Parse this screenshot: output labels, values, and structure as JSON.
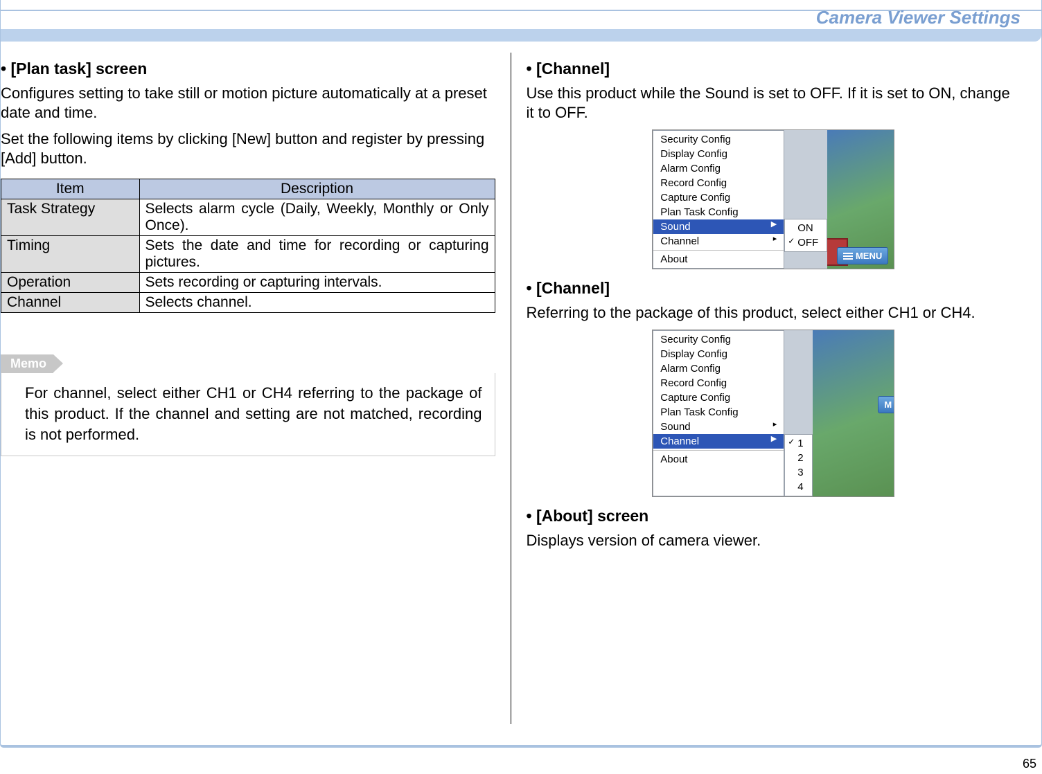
{
  "header": {
    "title": "Camera Viewer Settings"
  },
  "page_number": "65",
  "footer_ghost": "",
  "left": {
    "h1": "• [Plan task] screen",
    "p1": "Configures setting to take still or motion picture automatically at a preset date and time.",
    "p2": "Set the following items by clicking [New] button and register by pressing [Add] button.",
    "table": {
      "headers": [
        "Item",
        "Description"
      ],
      "rows": [
        {
          "item": "Task Strategy",
          "desc": "Selects alarm cycle (Daily, Weekly, Monthly or Only Once)."
        },
        {
          "item": "Timing",
          "desc": "Sets the date and time for recording or capturing pictures."
        },
        {
          "item": "Operation",
          "desc": "Sets recording or capturing intervals."
        },
        {
          "item": "Channel",
          "desc": "Selects channel."
        }
      ]
    },
    "memo_label": "Memo",
    "memo_text": "For channel, select either CH1 or CH4 referring to the package of this product. If the channel and setting are not matched, recording is not performed."
  },
  "right": {
    "h1": "• [Channel]",
    "p1": "Use this product while the Sound is set to OFF. If it is set to ON, change it to OFF.",
    "h2": "• [Channel]",
    "p2": "Referring to the package of this product, select either CH1 or CH4.",
    "h3": "• [About] screen",
    "p3": "Displays version of camera viewer."
  },
  "menu_items": {
    "m0": "Security Config",
    "m1": "Display Config",
    "m2": "Alarm Config",
    "m3": "Record Config",
    "m4": "Capture Config",
    "m5": "Plan Task Config",
    "m6": "Sound",
    "m7": "Channel",
    "m8": "About"
  },
  "sound_sub": {
    "on": "ON",
    "off": "OFF"
  },
  "channel_sub": {
    "c1": "1",
    "c2": "2",
    "c3": "3",
    "c4": "4"
  },
  "menu_button": "MENU"
}
